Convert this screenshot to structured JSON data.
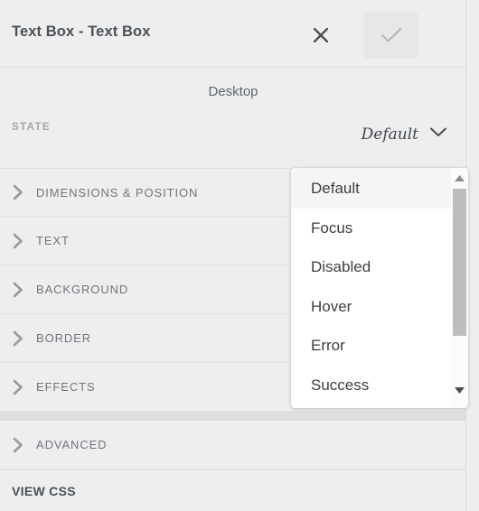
{
  "header": {
    "title": "Text Box - Text Box",
    "close_icon": "close-icon",
    "confirm_icon": "check-icon"
  },
  "device": {
    "label": "Desktop"
  },
  "state": {
    "label": "STATE",
    "value": "Default",
    "chevron_icon": "chevron-down-icon"
  },
  "accordion": {
    "sections": [
      {
        "label": "DIMENSIONS & POSITION",
        "icon": "chevron-right-icon"
      },
      {
        "label": "TEXT",
        "icon": "chevron-right-icon"
      },
      {
        "label": "BACKGROUND",
        "icon": "chevron-right-icon"
      },
      {
        "label": "BORDER",
        "icon": "chevron-right-icon"
      },
      {
        "label": "EFFECTS",
        "icon": "chevron-right-icon"
      }
    ],
    "advanced": {
      "label": "ADVANCED",
      "icon": "chevron-right-icon"
    },
    "view_css": {
      "label": "VIEW CSS"
    }
  },
  "dropdown": {
    "open": true,
    "selected": "Default",
    "options": [
      "Default",
      "Focus",
      "Disabled",
      "Hover",
      "Error",
      "Success"
    ],
    "scroll_up_icon": "triangle-up-icon",
    "scroll_down_icon": "triangle-down-icon"
  },
  "colors": {
    "panel_bg": "#eeeeee",
    "dropdown_bg": "#ffffff",
    "selected_item_bg": "#f5f5f5",
    "divider": "#e2e2e2",
    "section_gap": "#dedede",
    "title_text": "#4a5159",
    "label_text": "#6f757d",
    "muted_text": "#a5a5a5",
    "scrollbar_thumb": "#bdbdbd"
  }
}
